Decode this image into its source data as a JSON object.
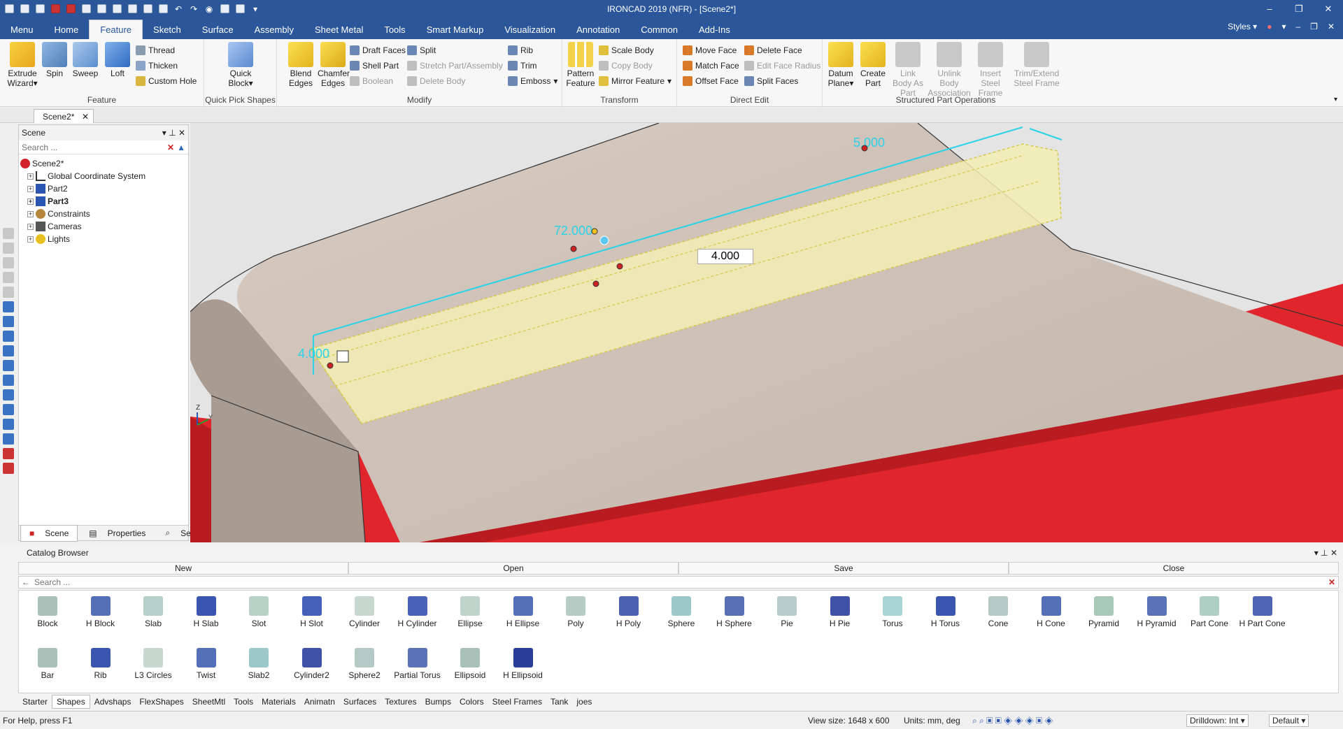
{
  "window": {
    "title": "IRONCAD 2019 (NFR) - [Scene2*]"
  },
  "menu_tabs": [
    "Menu",
    "Home",
    "Feature",
    "Sketch",
    "Surface",
    "Assembly",
    "Sheet Metal",
    "Tools",
    "Smart Markup",
    "Visualization",
    "Annotation",
    "Common",
    "Add-Ins"
  ],
  "active_tab": "Feature",
  "styles_label": "Styles",
  "ribbon": {
    "feature": {
      "label": "Feature",
      "extrude": "Extrude Wizard",
      "spin": "Spin",
      "sweep": "Sweep",
      "loft": "Loft",
      "thread": "Thread",
      "thicken": "Thicken",
      "custom_hole": "Custom Hole"
    },
    "quick_pick": {
      "label": "Quick Pick Shapes",
      "quick_block": "Quick Block"
    },
    "modify": {
      "label": "Modify",
      "blend": "Blend Edges",
      "chamfer": "Chamfer Edges",
      "draft_faces": "Draft Faces",
      "shell_part": "Shell Part",
      "boolean": "Boolean",
      "split": "Split",
      "stretch": "Stretch Part/Assembly",
      "delete_body": "Delete Body",
      "rib": "Rib",
      "trim": "Trim",
      "emboss": "Emboss"
    },
    "transform": {
      "label": "Transform",
      "pattern": "Pattern Feature",
      "scale_body": "Scale Body",
      "copy_body": "Copy Body",
      "mirror": "Mirror Feature"
    },
    "direct_edit": {
      "label": "Direct Edit",
      "move_face": "Move Face",
      "match_face": "Match Face",
      "offset_face": "Offset Face",
      "delete_face": "Delete Face",
      "edit_face_radius": "Edit Face Radius",
      "split_faces": "Split Faces"
    },
    "structured": {
      "label": "Structured Part Operations",
      "datum": "Datum Plane",
      "create_part": "Create Part",
      "link_body": "Link Body As Part",
      "unlink_body": "Unlink Body Association",
      "insert_steel": "Insert Steel Frame",
      "trim_extend": "Trim/Extend Steel Frame"
    }
  },
  "doc_tab": "Scene2*",
  "scene_panel": {
    "title": "Scene",
    "search_placeholder": "Search ...",
    "tree": [
      {
        "label": "Scene2*",
        "level": 0,
        "bold": false
      },
      {
        "label": "Global Coordinate System",
        "level": 1,
        "bold": false
      },
      {
        "label": "Part2",
        "level": 1,
        "bold": false
      },
      {
        "label": "Part3",
        "level": 1,
        "bold": true
      },
      {
        "label": "Constraints",
        "level": 1,
        "bold": false
      },
      {
        "label": "Cameras",
        "level": 1,
        "bold": false
      },
      {
        "label": "Lights",
        "level": 1,
        "bold": false
      }
    ],
    "tabs": [
      "Scene",
      "Properties",
      "Search"
    ]
  },
  "viewport": {
    "dim_length": "72.000",
    "dim_width": "5.000",
    "dim_height": "4.000",
    "input_value": "4.000",
    "axis_z": "Z",
    "axis_y": "Y",
    "colors": {
      "base": "#c8bcb3",
      "red": "#e0262c",
      "highlight": "#f2eeb4",
      "dim": "#29d3e8"
    }
  },
  "catalog": {
    "title": "Catalog Browser",
    "actions": [
      "New",
      "Open",
      "Save",
      "Close"
    ],
    "search_placeholder": "Search ...",
    "shapes_row1": [
      "Block",
      "H Block",
      "Slab",
      "H Slab",
      "Slot",
      "H Slot",
      "Cylinder",
      "H Cylinder",
      "Ellipse",
      "H Ellipse",
      "Poly",
      "H Poly",
      "Sphere",
      "H Sphere",
      "Pie",
      "H Pie",
      "Torus",
      "H Torus",
      "Cone",
      "H Cone",
      "Pyramid",
      "H Pyramid",
      "Part Cone",
      "H Part Cone"
    ],
    "shapes_row2": [
      "Bar",
      "Rib",
      "L3 Circles",
      "Twist",
      "Slab2",
      "Cylinder2",
      "Sphere2",
      "Partial Torus",
      "Ellipsoid",
      "H Ellipsoid"
    ],
    "tabs": [
      "Starter",
      "Shapes",
      "Advshaps",
      "FlexShapes",
      "SheetMtl",
      "Tools",
      "Materials",
      "Animatn",
      "Surfaces",
      "Textures",
      "Bumps",
      "Colors",
      "Steel Frames",
      "Tank",
      "joes"
    ],
    "active_tab": "Shapes"
  },
  "status": {
    "help": "For Help, press F1",
    "view_size": "View size: 1648 x  600",
    "units": "Units: mm, deg",
    "drilldown": "Drilldown: Int",
    "default": "Default"
  }
}
